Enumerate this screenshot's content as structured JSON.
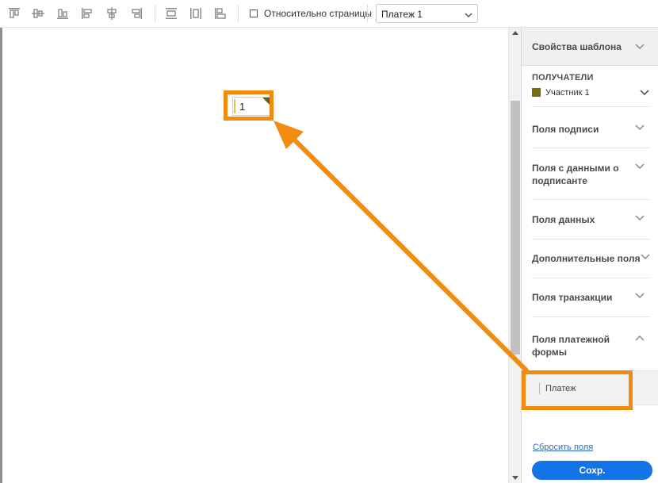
{
  "toolbar": {
    "icons": [
      "align-top-icon",
      "align-vertical-center-icon",
      "align-bottom-icon",
      "align-left-icon",
      "align-horizontal-center-icon",
      "align-right-icon",
      "distribute-vertical-icon",
      "distribute-horizontal-icon",
      "match-size-icon"
    ],
    "relative_to_page_label": "Относительно страницы",
    "relative_to_page_checked": false,
    "page_select_value": "Платеж 1"
  },
  "canvas": {
    "field_value": "1",
    "field_marker_color": "#6a5b12"
  },
  "panel": {
    "title": "Свойства шаблона",
    "recipients_label": "ПОЛУЧАТЕЛИ",
    "recipient_name": "Участник 1",
    "recipient_color": "#7a6a10",
    "sections": [
      "Поля подписи",
      "Поля с данными о подписанте",
      "Поля данных",
      "Дополнительные поля",
      "Поля транзакции",
      "Поля платежной формы"
    ],
    "payment_item": "Платеж",
    "reset_link": "Сбросить поля",
    "save_button": "Сохр."
  },
  "colors": {
    "accent": "#1473e6",
    "annotation": "#f28c0f"
  }
}
